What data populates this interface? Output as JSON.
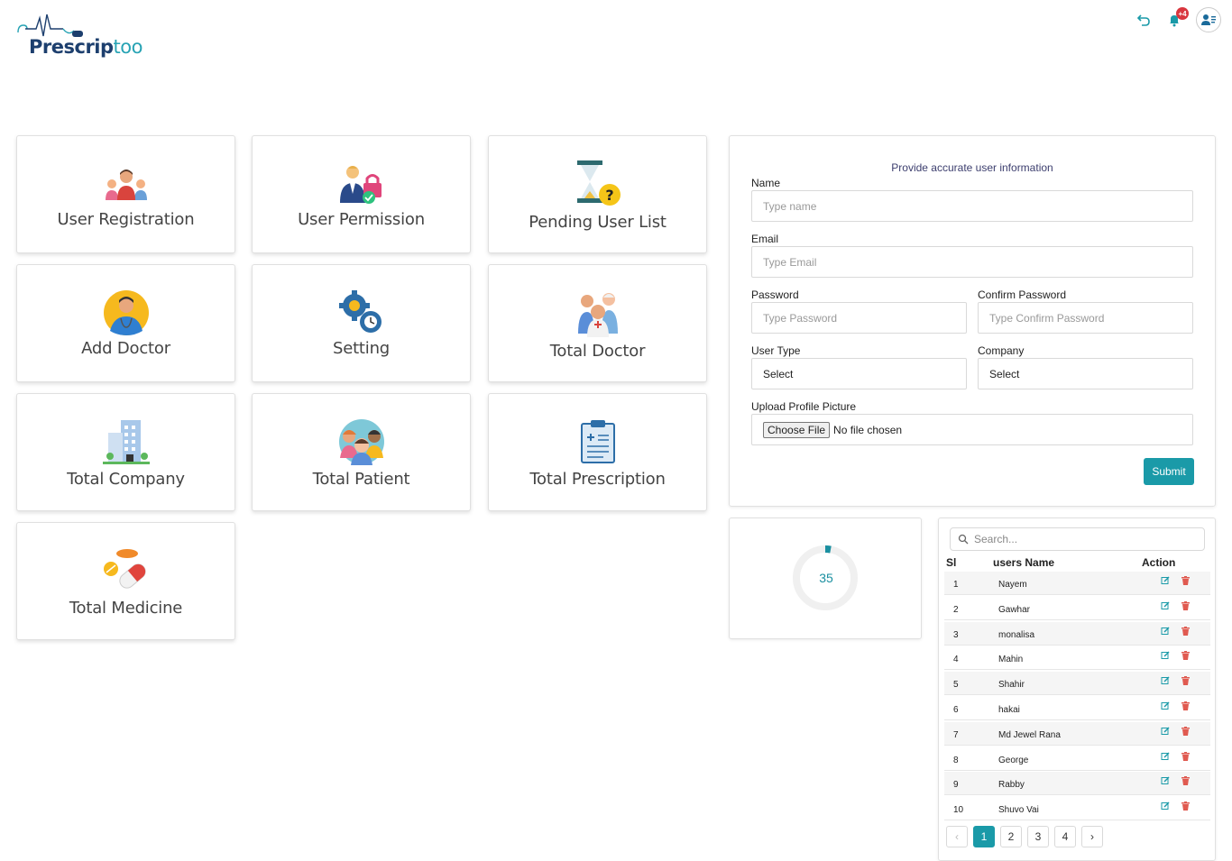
{
  "brand": {
    "name_main": "Prescrip",
    "name_accent": "too"
  },
  "header": {
    "notification_count": "+4"
  },
  "cards": [
    {
      "label": "User Registration",
      "icon": "users-group-icon"
    },
    {
      "label": "User Permission",
      "icon": "user-lock-icon"
    },
    {
      "label": "Pending User List",
      "icon": "hourglass-question-icon"
    },
    {
      "label": "Add Doctor",
      "icon": "doctor-icon"
    },
    {
      "label": "Setting",
      "icon": "gears-icon"
    },
    {
      "label": "Total Doctor",
      "icon": "doctors-group-icon"
    },
    {
      "label": "Total Company",
      "icon": "building-icon"
    },
    {
      "label": "Total Patient",
      "icon": "patients-group-icon"
    },
    {
      "label": "Total Prescription",
      "icon": "clipboard-icon"
    },
    {
      "label": "Total Medicine",
      "icon": "pills-icon"
    }
  ],
  "form": {
    "title": "Provide accurate user information",
    "name_label": "Name",
    "name_placeholder": "Type name",
    "email_label": "Email",
    "email_placeholder": "Type Email",
    "password_label": "Password",
    "password_placeholder": "Type Password",
    "confirm_label": "Confirm Password",
    "confirm_placeholder": "Type Confirm Password",
    "usertype_label": "User Type",
    "usertype_value": "Select",
    "company_label": "Company",
    "company_value": "Select",
    "upload_label": "Upload Profile Picture",
    "file_button": "Choose File",
    "file_status": "No file chosen",
    "submit_label": "Submit"
  },
  "stat": {
    "value": "35",
    "fill_fraction": 0.03,
    "color": "#1a8fa0"
  },
  "users_table": {
    "search_placeholder": "Search...",
    "col_si": "Sl",
    "col_name": "users Name",
    "col_action": "Action",
    "rows": [
      {
        "si": "1",
        "name": "Nayem"
      },
      {
        "si": "2",
        "name": "Gawhar"
      },
      {
        "si": "3",
        "name": "monalisa"
      },
      {
        "si": "4",
        "name": "Mahin"
      },
      {
        "si": "5",
        "name": "Shahir"
      },
      {
        "si": "6",
        "name": "hakai"
      },
      {
        "si": "7",
        "name": "Md Jewel Rana"
      },
      {
        "si": "8",
        "name": "George"
      },
      {
        "si": "9",
        "name": "Rabby"
      },
      {
        "si": "10",
        "name": "Shuvo Vai"
      }
    ],
    "pages": [
      "1",
      "2",
      "3",
      "4"
    ],
    "prev": "‹",
    "next": "›"
  }
}
